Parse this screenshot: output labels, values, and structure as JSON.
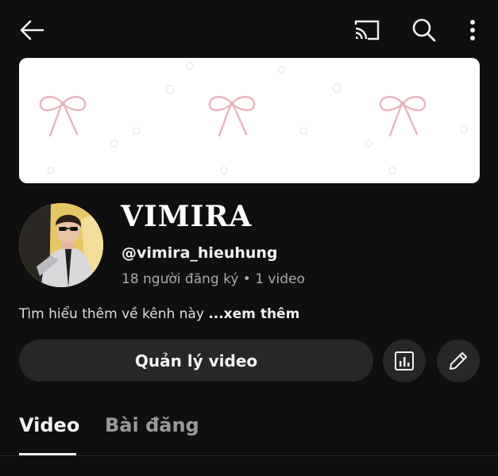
{
  "channel": {
    "name": "VIMIRA",
    "handle": "@vimira_hieuhung",
    "stats": "18 người đăng ký • 1 video",
    "about": "Tìm hiểu thêm về kênh này",
    "more_link": "...xem thêm"
  },
  "actions": {
    "manage_videos": "Quản lý video"
  },
  "tabs": [
    {
      "label": "Video",
      "active": true
    },
    {
      "label": "Bài đăng",
      "active": false
    }
  ],
  "icons": {
    "back": "back-arrow-icon",
    "cast": "cast-icon",
    "search": "search-icon",
    "more": "more-vertical-icon",
    "analytics": "analytics-icon",
    "edit": "pencil-icon"
  },
  "colors": {
    "background": "#0f0f0f",
    "button": "#272727",
    "banner": "#ffffff",
    "bow": "#e8b5bd"
  }
}
